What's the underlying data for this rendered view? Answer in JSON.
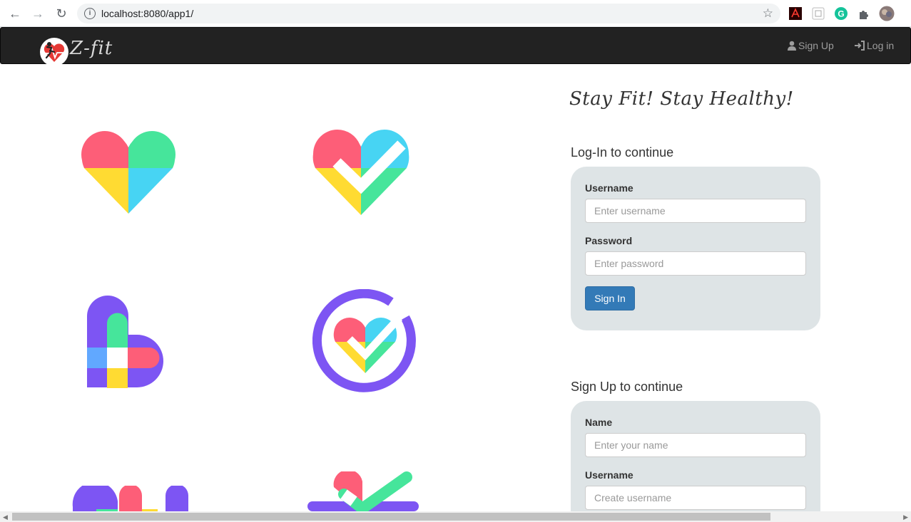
{
  "browser": {
    "url": "localhost:8080/app1/",
    "back_glyph": "←",
    "forward_glyph": "→",
    "reload_glyph": "↻",
    "info_glyph": "i",
    "star_glyph": "☆"
  },
  "navbar": {
    "brand_text": "Z-fit",
    "links": [
      {
        "label": "Sign Up",
        "icon": "user-icon"
      },
      {
        "label": "Log in",
        "icon": "login-icon"
      }
    ]
  },
  "tagline": "Stay Fit! Stay Healthy!",
  "login": {
    "title": "Log-In to continue",
    "username_label": "Username",
    "username_placeholder": "Enter username",
    "password_label": "Password",
    "password_placeholder": "Enter password",
    "submit_label": "Sign In"
  },
  "signup": {
    "title": "Sign Up to continue",
    "name_label": "Name",
    "name_placeholder": "Enter your name",
    "username_label": "Username",
    "username_placeholder": "Create username"
  },
  "colors": {
    "navbar_bg": "#222222",
    "panel_bg": "#dee4e6",
    "primary": "#337ab7",
    "heart_red": "#fd5e78",
    "heart_green": "#46e59b",
    "heart_yellow": "#ffdb32",
    "heart_blue": "#47d4f3",
    "purple": "#7d55f3"
  }
}
